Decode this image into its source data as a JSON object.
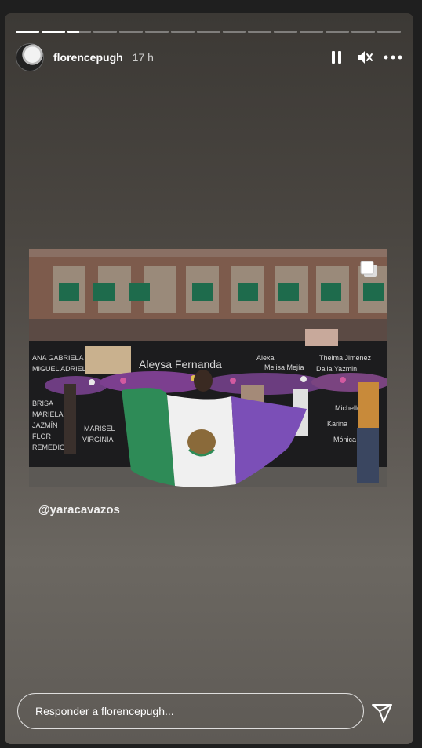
{
  "story": {
    "username": "florencepugh",
    "time_ago": "17 h",
    "progress": {
      "segments": 15,
      "completed": 2,
      "current_fraction": 0.5
    },
    "mention": "@yaracavazos",
    "reply_placeholder": "Responder a florencepugh..."
  },
  "icons": {
    "pause": "pause-icon",
    "mute": "volume-muted-icon",
    "more": "more-options-icon",
    "multi": "multiple-photos-icon",
    "send": "send-paper-plane-icon"
  },
  "colors": {
    "flag_green": "#2e8b57",
    "flag_purple": "#7b4fb7",
    "flag_white": "#f0f0f0"
  }
}
